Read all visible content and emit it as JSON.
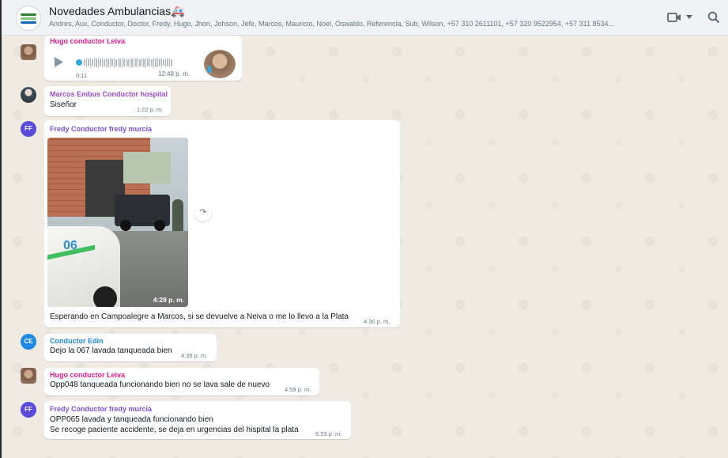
{
  "header": {
    "title": "Novedades Ambulancias🚑",
    "participants": "Andres, Aux, Conductor, Doctor, Fredy, Hugo, Jhon, Johson, Jefe, Marcos, Mauricio, Noel, Oswaldo, Referencia, Sub, Wilson, +57 310 2611101, +57 320 9522954, +57 311 8534...",
    "video_icon": "video-call-icon",
    "search_icon": "search-icon"
  },
  "colors": {
    "chat_bg": "#efeae2",
    "header_bg": "#f0f2f5",
    "hugo": "#e91e8c",
    "marcos": "#9c4dcc",
    "fredy": "#7b4fd6",
    "edin": "#1e88e5"
  },
  "messages": [
    {
      "sender": "Hugo conductor Leiva",
      "type": "audio",
      "duration": "0:11",
      "time": "12:48 p. m."
    },
    {
      "sender": "Marcos Embus Conductor hospital",
      "text": "Siseñor",
      "time": "1:22 p. m."
    },
    {
      "sender": "Fredy Conductor fredy murcia",
      "type": "image",
      "image_time": "4:28 p. m.",
      "text": "Esperando en Campoalegre a Marcos, si se devuelve a Neiva o me lo llevo a la Plata",
      "time": "4:30 p. m."
    },
    {
      "avatar": "CE",
      "sender": "Conductor Edin",
      "text": "Dejo la 067 lavada tanqueada bien",
      "time": "4:39 p. m."
    },
    {
      "sender": "Hugo conductor Leiva",
      "text": "Opp048 tanqueada funcionando bien no se lava sale de nuevo",
      "time": "4:59 p. m."
    },
    {
      "avatar": "FF",
      "sender": "Fredy Conductor fredy murcia",
      "text": "OPP065 lavada y tanqueada funcionando bien",
      "text2": "Se recoge paciente accidente, se deja en urgencias del hispital la plata",
      "time": "6:53 p. m."
    }
  ],
  "photo_badge": "06",
  "avatars": {
    "ff": "FF",
    "ce": "CE"
  }
}
